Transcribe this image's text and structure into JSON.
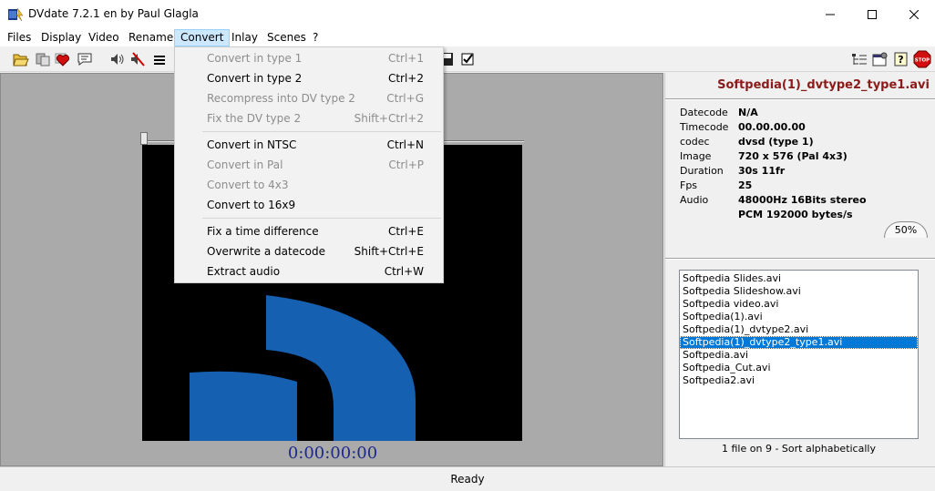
{
  "window": {
    "title": "DVdate 7.2.1 en by Paul Glagla"
  },
  "menu": [
    {
      "label": "Files"
    },
    {
      "label": "Display"
    },
    {
      "label": "Video"
    },
    {
      "label": "Rename"
    },
    {
      "label": "Convert"
    },
    {
      "label": "Inlay"
    },
    {
      "label": "Scenes"
    },
    {
      "label": "?"
    }
  ],
  "convert_menu": [
    {
      "label": "Convert in type 1",
      "shortcut": "Ctrl+1",
      "enabled": false
    },
    {
      "label": "Convert in type 2",
      "shortcut": "Ctrl+2",
      "enabled": true
    },
    {
      "label": "Recompress into DV type 2",
      "shortcut": "Ctrl+G",
      "enabled": false
    },
    {
      "label": "Fix the DV type 2",
      "shortcut": "Shift+Ctrl+2",
      "enabled": false
    },
    {
      "label": "Convert in NTSC",
      "shortcut": "Ctrl+N",
      "enabled": true
    },
    {
      "label": "Convert in Pal",
      "shortcut": "Ctrl+P",
      "enabled": false
    },
    {
      "label": "Convert to 4x3",
      "shortcut": "",
      "enabled": false
    },
    {
      "label": "Convert to 16x9",
      "shortcut": "",
      "enabled": true
    },
    {
      "label": "Fix a time difference",
      "shortcut": "Ctrl+E",
      "enabled": true
    },
    {
      "label": "Overwrite a datecode",
      "shortcut": "Shift+Ctrl+E",
      "enabled": true
    },
    {
      "label": "Extract audio",
      "shortcut": "Ctrl+W",
      "enabled": true
    }
  ],
  "preview": {
    "timecode": "0:00:00:00"
  },
  "info": {
    "filename": "Softpedia(1)_dvtype2_type1.avi",
    "datecode_label": "Datecode",
    "datecode": "N/A",
    "timecode_label": "Timecode",
    "timecode": "00.00.00.00",
    "codec_label": "codec",
    "codec": "dvsd (type 1)",
    "image_label": "Image",
    "image": "720 x 576 (Pal 4x3)",
    "duration_label": "Duration",
    "duration": "30s 11fr",
    "fps_label": "Fps",
    "fps": "25",
    "audio_label": "Audio",
    "audio": "48000Hz 16Bits stereo",
    "audio2": "PCM 192000 bytes/s",
    "zoom": "50%"
  },
  "files": [
    "Softpedia Slides.avi",
    "Softpedia Slideshow.avi",
    "Softpedia video.avi",
    "Softpedia(1).avi",
    "Softpedia(1)_dvtype2.avi",
    "Softpedia(1)_dvtype2_type1.avi",
    "Softpedia.avi",
    "Softpedia_Cut.avi",
    "Softpedia2.avi"
  ],
  "selected_file": "Softpedia(1)_dvtype2_type1.avi",
  "list_status": "1 file on 9 - Sort alphabetically",
  "status": "Ready",
  "colors": {
    "filename": "#8b1a1a",
    "timecode": "#1e2a8a",
    "selection": "#0078d7",
    "logo_blue": "#1560b0",
    "menu_hover": "#91c9f7"
  }
}
